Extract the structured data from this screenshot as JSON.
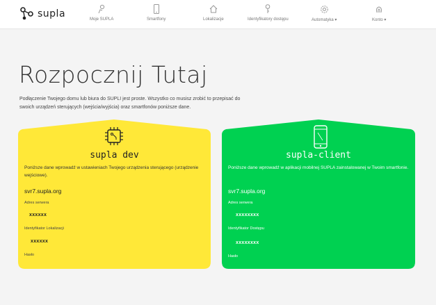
{
  "brand": {
    "name": "supla"
  },
  "nav": {
    "items": [
      {
        "label": "Moje SUPLA",
        "icon": "gear-hand-icon"
      },
      {
        "label": "Smartfony",
        "icon": "smartphone-icon"
      },
      {
        "label": "Lokalizacje",
        "icon": "house-icon"
      },
      {
        "label": "Identyfikatory dostępu",
        "icon": "key-icon"
      },
      {
        "label": "Automatyka ▾",
        "icon": "gear-icon"
      },
      {
        "label": "Konto ▾",
        "icon": "fingerprint-icon"
      }
    ]
  },
  "page": {
    "title": "Rozpocznij Tutaj",
    "intro": "Podłączenie Twojego domu lub biura do SUPLI jest proste. Wszystko co musisz zrobić to przepisać do swoich urządzeń sterujących (wejścia/wyjścia) oraz smartfonów poniższe dane."
  },
  "cards": {
    "dev": {
      "title": "supla dev",
      "description": "Poniższe dane wprowadź w ustawieniach Twojego urządzenia sterującego (urządzenie wejściowe).",
      "server": "svr7.supla.org",
      "server_label": "Adres serwera",
      "field1_value": "xxxxxx",
      "field2_label": "Identyfikator Lokalizacji",
      "field2_value": "xxxxxx",
      "field3_label": "Hasło",
      "color": "#ffe838",
      "icon": "chip-icon"
    },
    "client": {
      "title": "supla-client",
      "description": "Poniższe dane wprowadź w aplikacji mobilnej SUPLA zainstalowanej w Twoim smartfonie.",
      "server": "svr7.supla.org",
      "server_label": "Adres serwera",
      "field1_value": "xxxxxxxx",
      "field2_label": "Identyfikator Dostępu",
      "field2_value": "xxxxxxxx",
      "field3_label": "Hasło",
      "color": "#00d151",
      "icon": "smartphone-icon"
    }
  }
}
